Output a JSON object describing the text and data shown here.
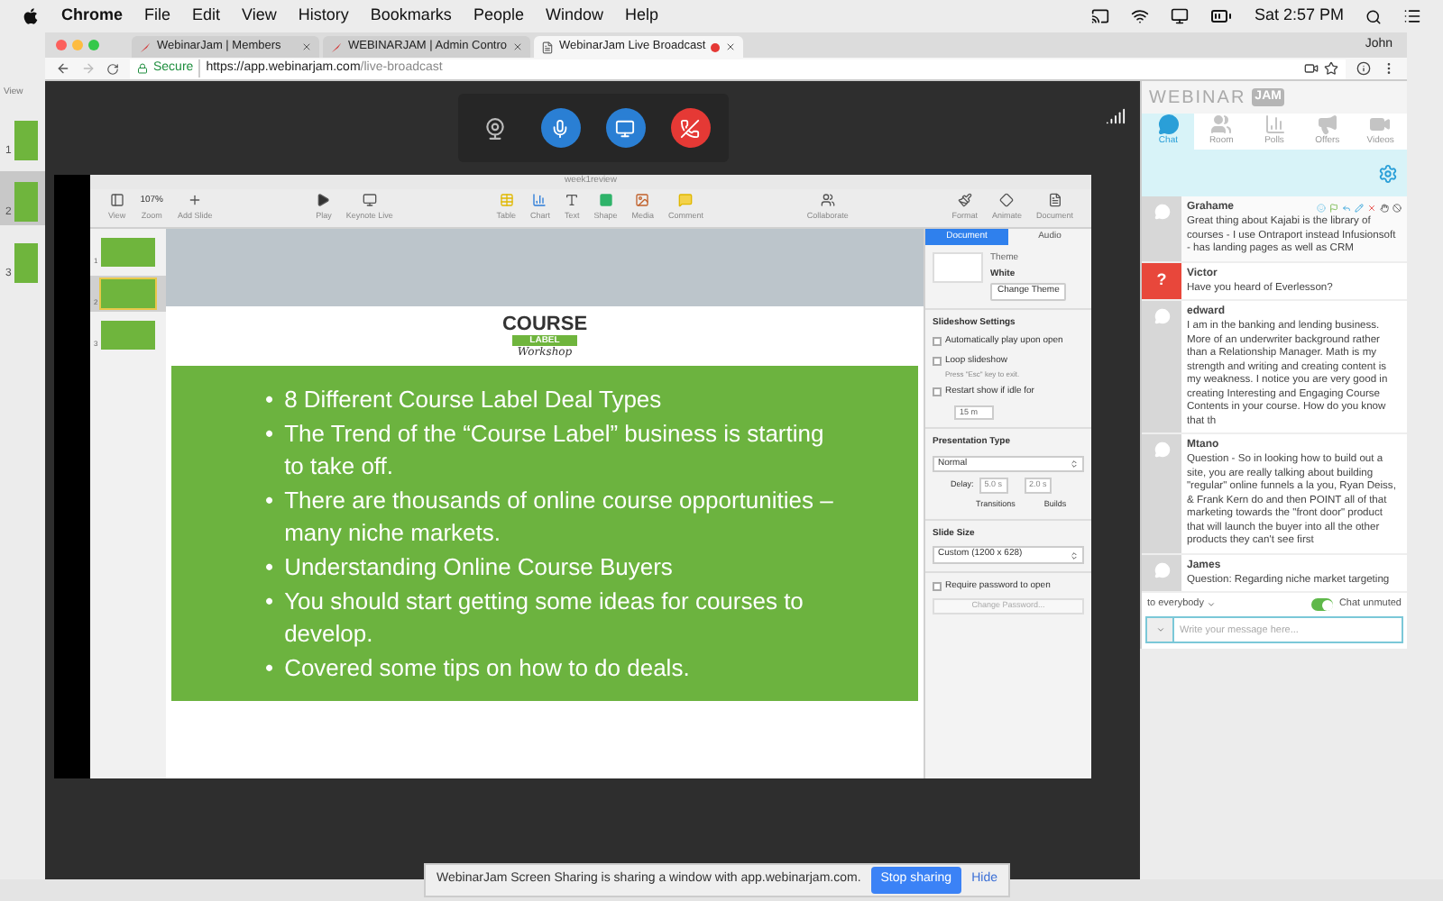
{
  "menubar": {
    "app": "Chrome",
    "menus": [
      "File",
      "Edit",
      "View",
      "History",
      "Bookmarks",
      "People",
      "Window",
      "Help"
    ],
    "clock": "Sat 2:57 PM"
  },
  "behind_window": {
    "label": "View",
    "slides": [
      {
        "number": "1",
        "selected": false
      },
      {
        "number": "2",
        "selected": true
      },
      {
        "number": "3",
        "selected": false
      }
    ]
  },
  "browser": {
    "tabs": [
      {
        "title": "WebinarJam | Members",
        "selected": false,
        "recording": false
      },
      {
        "title": "WEBINARJAM | Admin Contro",
        "selected": false,
        "recording": false
      },
      {
        "title": "WebinarJam Live Broadcast",
        "selected": true,
        "recording": true
      }
    ],
    "profile": "John",
    "secure_label": "Secure",
    "url_host": "https://app.webinarjam.com",
    "url_path": "/live-broadcast"
  },
  "broadcast_controls": [
    {
      "kind": "webcam",
      "on": false
    },
    {
      "kind": "mic",
      "on": true
    },
    {
      "kind": "screen",
      "on": true
    },
    {
      "kind": "hangup",
      "on": true
    }
  ],
  "keynote": {
    "title": "week1review",
    "zoom": "107%",
    "toolbar": [
      {
        "kind": "view",
        "label": "View"
      },
      {
        "kind": "zoom",
        "label": "Zoom"
      },
      {
        "kind": "add",
        "label": "Add Slide"
      },
      {
        "kind": "play",
        "label": "Play"
      },
      {
        "kind": "live",
        "label": "Keynote Live"
      },
      {
        "kind": "table",
        "label": "Table"
      },
      {
        "kind": "chart",
        "label": "Chart"
      },
      {
        "kind": "text",
        "label": "Text"
      },
      {
        "kind": "shape",
        "label": "Shape"
      },
      {
        "kind": "media",
        "label": "Media"
      },
      {
        "kind": "comment",
        "label": "Comment"
      },
      {
        "kind": "collaborate",
        "label": "Collaborate"
      },
      {
        "kind": "format",
        "label": "Format"
      },
      {
        "kind": "animate",
        "label": "Animate"
      },
      {
        "kind": "document",
        "label": "Document"
      }
    ],
    "slides": [
      {
        "number": "1",
        "selected": false
      },
      {
        "number": "2",
        "selected": true
      },
      {
        "number": "3",
        "selected": false
      }
    ],
    "slide": {
      "logo_top": "COURSE",
      "logo_mid": "LABEL",
      "logo_script": "Workshop",
      "marker": "•",
      "bullets": [
        "8 Different Course Label Deal Types",
        "The Trend of the “Course Label” business is starting to take off.",
        "There are thousands of online course opportunities – many niche markets.",
        "Understanding Online Course Buyers",
        "You should start getting some ideas for courses to develop.",
        "Covered some tips on how to do deals."
      ]
    },
    "inspector": {
      "tabs": [
        {
          "label": "Document",
          "selected": true
        },
        {
          "label": "Audio",
          "selected": false
        }
      ],
      "theme_label": "Theme",
      "theme_name": "White",
      "change_theme": "Change Theme",
      "slideshow_heading": "Slideshow Settings",
      "options": [
        {
          "label": "Automatically play upon open",
          "checked": false
        },
        {
          "label": "Loop slideshow",
          "checked": false,
          "hint": "Press \"Esc\" key to exit."
        },
        {
          "label": "Restart show if idle for",
          "checked": false
        }
      ],
      "idle_value": "15 m",
      "presentation_heading": "Presentation Type",
      "presentation_value": "Normal",
      "delay_label": "Delay:",
      "transitions_value": "5.0 s",
      "builds_value": "2.0 s",
      "transitions_label": "Transitions",
      "builds_label": "Builds",
      "size_heading": "Slide Size",
      "size_value": "Custom (1200 x 628)",
      "password": {
        "label": "Require password to open",
        "checked": false
      },
      "change_password": "Change Password..."
    }
  },
  "chat": {
    "brand": "WEBINAR",
    "brand_badge": "JAM",
    "tabs": [
      {
        "label": "Chat",
        "kind": "chat",
        "selected": true
      },
      {
        "label": "Room",
        "kind": "room",
        "selected": false
      },
      {
        "label": "Polls",
        "kind": "polls",
        "selected": false
      },
      {
        "label": "Offers",
        "kind": "offers",
        "selected": false
      },
      {
        "label": "Videos",
        "kind": "videos",
        "selected": false
      }
    ],
    "messages": [
      {
        "author": "Grahame",
        "kind": "comment",
        "hovered": true,
        "text": "Great thing about Kajabi is the library of courses - I use Ontraport instead Infusionsoft - has landing pages as well as CRM"
      },
      {
        "author": "Victor",
        "kind": "question",
        "hovered": false,
        "text": "Have you heard of Everlesson?"
      },
      {
        "author": "edward",
        "kind": "comment",
        "hovered": false,
        "text": "I am in the banking and lending business. More of an underwriter background rather than a Relationship Manager. Math is my strength and writing and creating content is my weakness. I notice you are very good in creating Interesting and Engaging Course Contents in your course. How do you know that th"
      },
      {
        "author": "Mtano",
        "kind": "comment",
        "hovered": false,
        "text": "Question - So in looking how to build out a site, you are really talking about building \"regular\" online funnels a la you, Ryan Deiss, & Frank Kern do and then POINT all of that marketing towards the \"front door\" product that will launch the buyer into all the other products they can't see first"
      },
      {
        "author": "James",
        "kind": "comment",
        "hovered": false,
        "text": "Question: Regarding niche market targeting"
      }
    ],
    "question_icon": "?",
    "recipient": "to everybody",
    "unmuted": true,
    "mute_label": "Chat unmuted",
    "input_placeholder": "Write your message here..."
  },
  "share_bar": {
    "message": "WebinarJam Screen Sharing is sharing a window with app.webinarjam.com.",
    "stop": "Stop sharing",
    "hide": "Hide"
  }
}
